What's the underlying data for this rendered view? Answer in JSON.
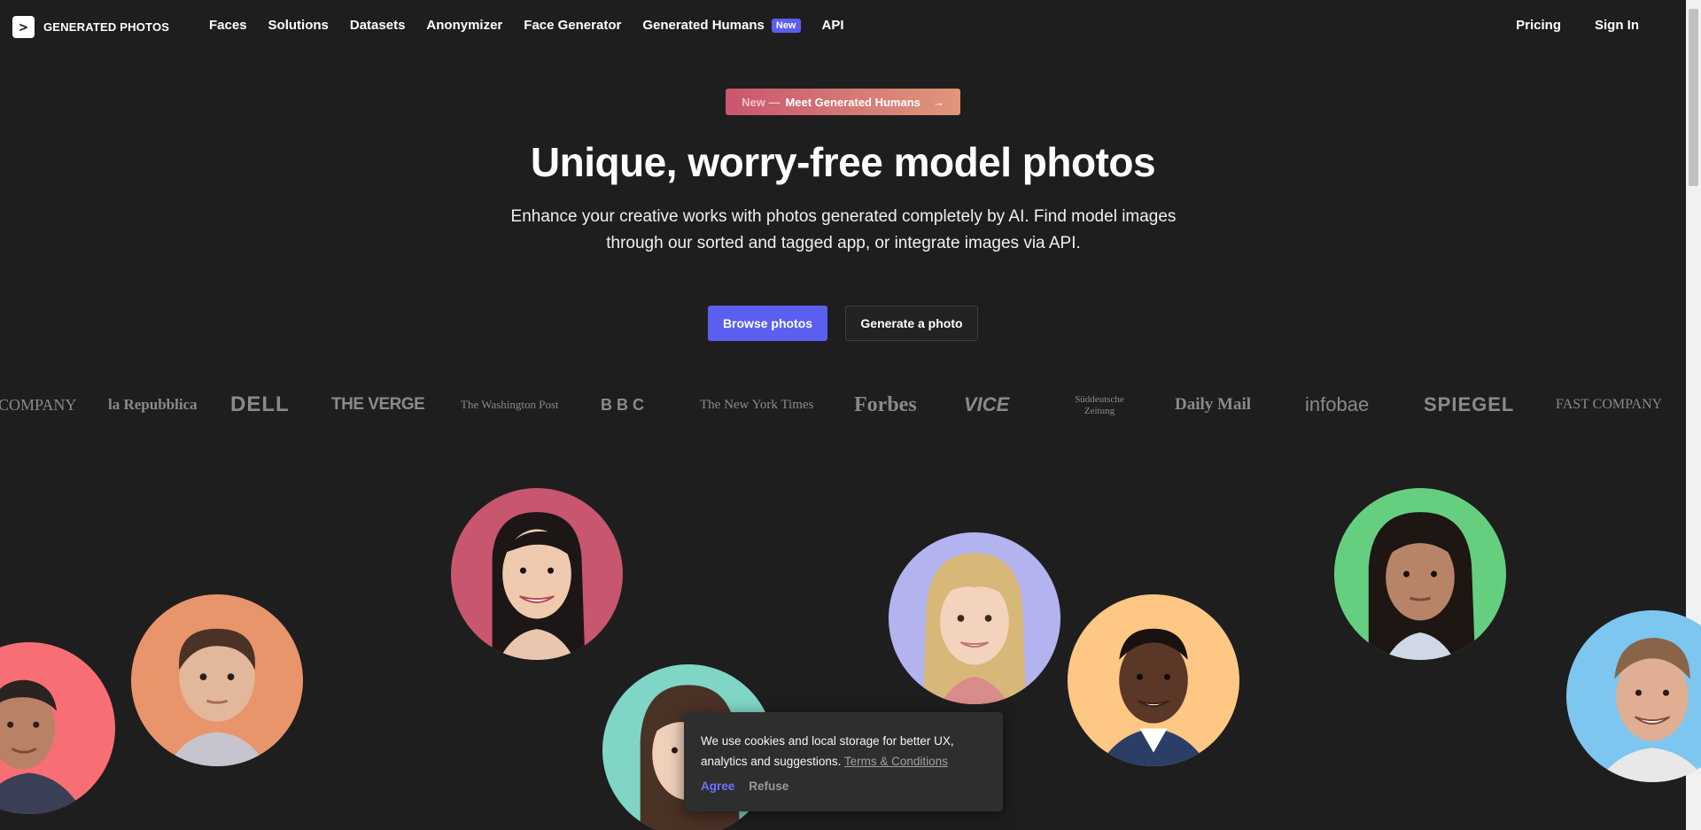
{
  "brand": {
    "name": "GENERATED PHOTOS",
    "logo_glyph": ">"
  },
  "nav": {
    "links": [
      {
        "label": "Faces"
      },
      {
        "label": "Solutions"
      },
      {
        "label": "Datasets"
      },
      {
        "label": "Anonymizer"
      },
      {
        "label": "Face Generator"
      },
      {
        "label": "Generated Humans",
        "badge": "New"
      },
      {
        "label": "API"
      }
    ],
    "pricing": "Pricing",
    "sign_in": "Sign In"
  },
  "promo": {
    "prefix": "New —",
    "text": "Meet Generated Humans",
    "arrow": "→"
  },
  "hero": {
    "title": "Unique, worry-free model photos",
    "subtitle_line1": "Enhance your creative works with photos generated completely by AI. Find model images",
    "subtitle_line2": "through our sorted and tagged app, or integrate images via API.",
    "primary_button": "Browse photos",
    "secondary_button": "Generate a photo"
  },
  "press_logos": [
    "COMPANY",
    "la Repubblica",
    "DELL",
    "THE VERGE",
    "The Washington Post",
    "BBC",
    "The New York Times",
    "Forbes",
    "VICE",
    "Süddeutsche Zeitung",
    "Daily Mail",
    "infobae",
    "SPIEGEL",
    "FAST COMPANY"
  ],
  "faces": [
    {
      "name": "face-man-red",
      "bg": "#f76f74"
    },
    {
      "name": "face-boy-orange",
      "bg": "#e8956c"
    },
    {
      "name": "face-woman-pink",
      "bg": "#c8566e"
    },
    {
      "name": "face-woman-teal",
      "bg": "#7fd6c7"
    },
    {
      "name": "face-girl-lavender",
      "bg": "#b3b3f0"
    },
    {
      "name": "face-man-peach",
      "bg": "#ffc784"
    },
    {
      "name": "face-girl-green",
      "bg": "#66cf7f"
    },
    {
      "name": "face-man-blue",
      "bg": "#7cc6f0"
    }
  ],
  "cookie": {
    "text": "We use cookies and local storage for better UX, analytics and suggestions.",
    "link": "Terms & Conditions",
    "agree": "Agree",
    "refuse": "Refuse"
  },
  "colors": {
    "background": "#1e1e1e",
    "accent": "#5a5ff0",
    "promo_start": "#c9566e",
    "promo_end": "#e0977a"
  }
}
